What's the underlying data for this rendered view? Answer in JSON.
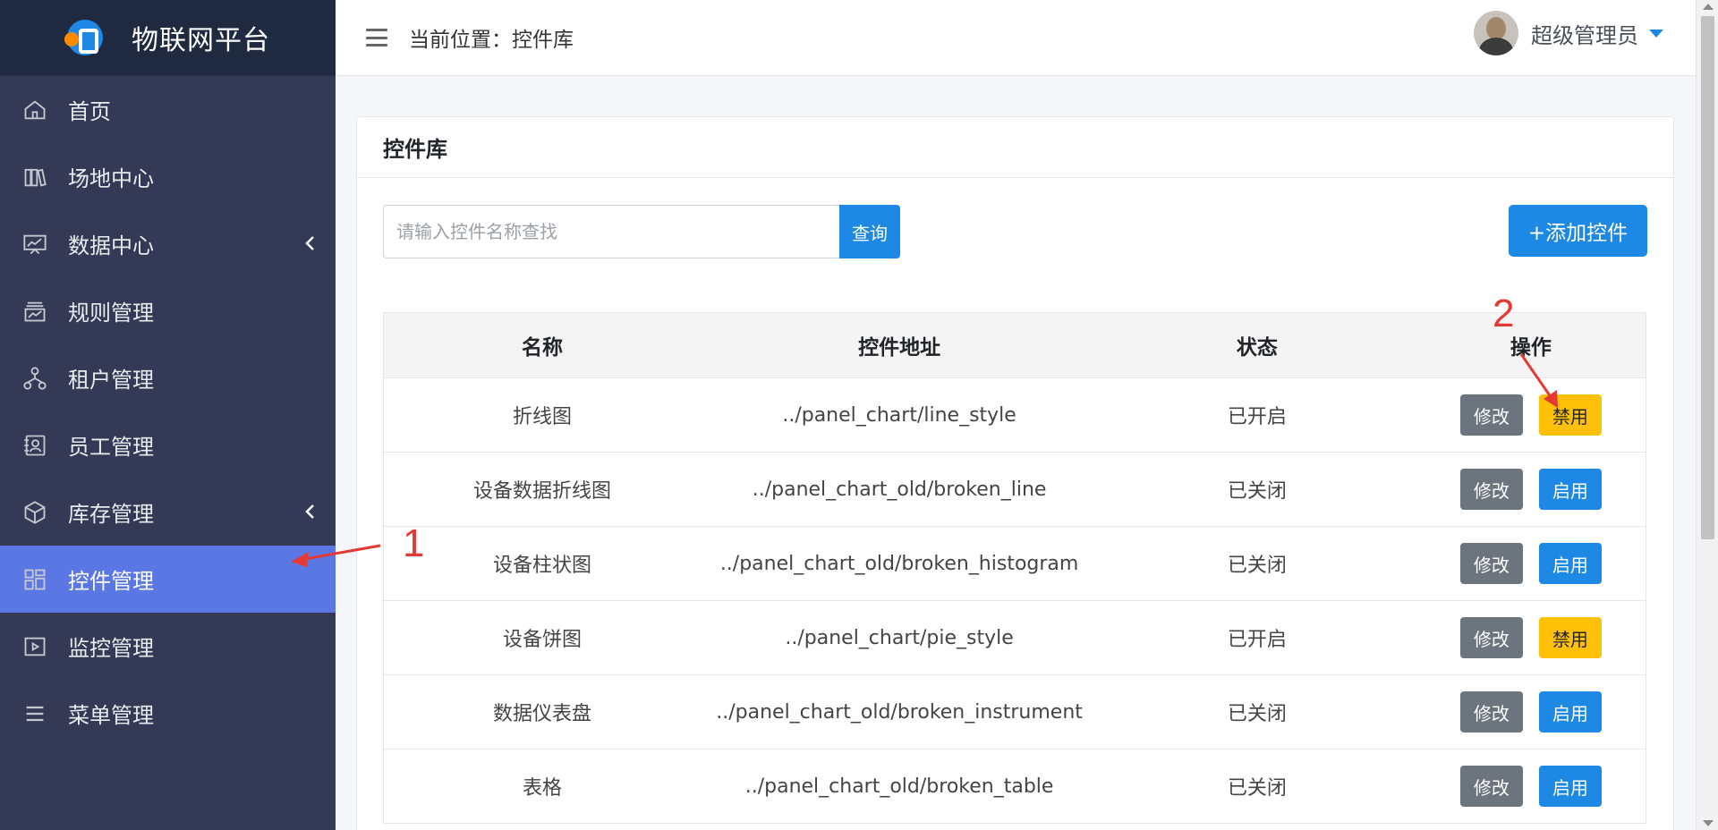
{
  "sidebar": {
    "brand": "物联网平台",
    "items": [
      {
        "label": "首页",
        "icon": "home-icon",
        "has_submenu": false,
        "active": false
      },
      {
        "label": "场地中心",
        "icon": "books-icon",
        "has_submenu": false,
        "active": false
      },
      {
        "label": "数据中心",
        "icon": "chart-board-icon",
        "has_submenu": true,
        "active": false
      },
      {
        "label": "规则管理",
        "icon": "inbox-chart-icon",
        "has_submenu": false,
        "active": false
      },
      {
        "label": "租户管理",
        "icon": "org-tree-icon",
        "has_submenu": false,
        "active": false
      },
      {
        "label": "员工管理",
        "icon": "contact-card-icon",
        "has_submenu": false,
        "active": false
      },
      {
        "label": "库存管理",
        "icon": "cube-icon",
        "has_submenu": true,
        "active": false
      },
      {
        "label": "控件管理",
        "icon": "grid-icon",
        "has_submenu": false,
        "active": true
      },
      {
        "label": "监控管理",
        "icon": "play-box-icon",
        "has_submenu": false,
        "active": false
      },
      {
        "label": "菜单管理",
        "icon": "list-icon",
        "has_submenu": false,
        "active": false
      }
    ]
  },
  "header": {
    "breadcrumb": "当前位置：控件库",
    "user_name": "超级管理员"
  },
  "card": {
    "title": "控件库",
    "search_placeholder": "请输入控件名称查找",
    "search_button": "查询",
    "add_button": "+添加控件"
  },
  "table": {
    "headers": [
      "名称",
      "控件地址",
      "状态",
      "操作"
    ],
    "edit_label": "修改",
    "rows": [
      {
        "name": "折线图",
        "address": "../panel_chart/line_style",
        "status": "已开启",
        "toggle": "禁用",
        "toggle_type": "disable"
      },
      {
        "name": "设备数据折线图",
        "address": "../panel_chart_old/broken_line",
        "status": "已关闭",
        "toggle": "启用",
        "toggle_type": "enable"
      },
      {
        "name": "设备柱状图",
        "address": "../panel_chart_old/broken_histogram",
        "status": "已关闭",
        "toggle": "启用",
        "toggle_type": "enable"
      },
      {
        "name": "设备饼图",
        "address": "../panel_chart/pie_style",
        "status": "已开启",
        "toggle": "禁用",
        "toggle_type": "disable"
      },
      {
        "name": "数据仪表盘",
        "address": "../panel_chart_old/broken_instrument",
        "status": "已关闭",
        "toggle": "启用",
        "toggle_type": "enable"
      },
      {
        "name": "表格",
        "address": "../panel_chart_old/broken_table",
        "status": "已关闭",
        "toggle": "启用",
        "toggle_type": "enable"
      }
    ]
  },
  "annotations": {
    "marker_1": "1",
    "marker_2": "2",
    "color": "#e53935"
  },
  "colors": {
    "primary": "#1e88e5",
    "warning": "#ffc107",
    "secondary": "#6c757d",
    "sidebar_bg": "#343a55",
    "sidebar_active": "#5b77e3"
  }
}
